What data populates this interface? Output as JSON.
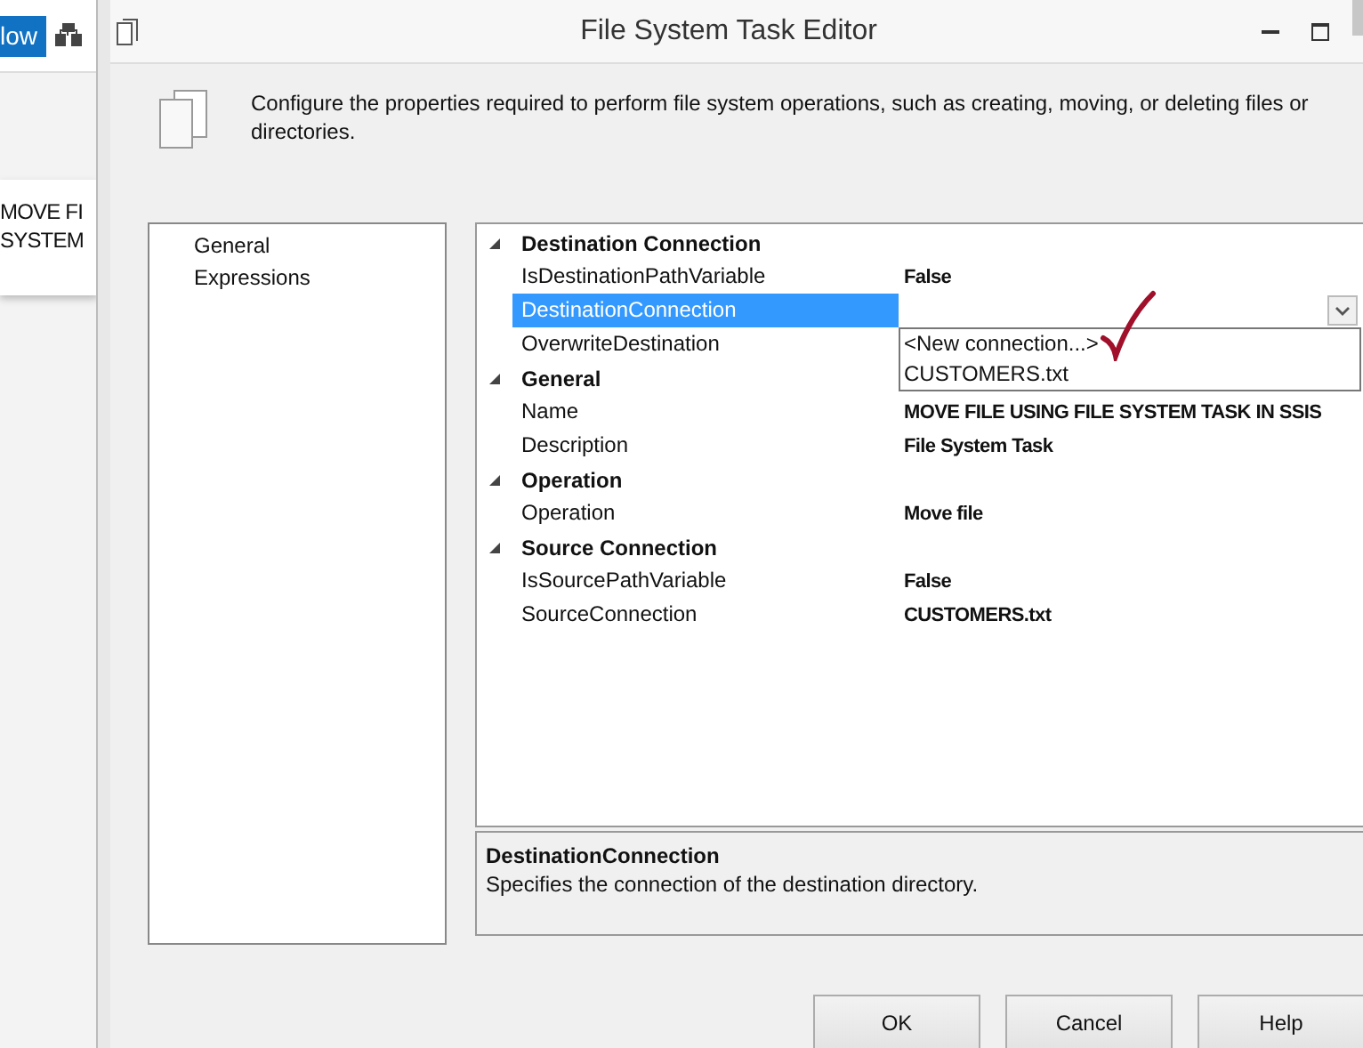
{
  "ide": {
    "toolbar_button": "low",
    "task_label_lines": [
      "MOVE FI",
      "SYSTEM"
    ]
  },
  "dialog": {
    "title": "File System Task Editor",
    "description": "Configure the properties required to perform file system operations, such as creating, moving, or deleting files or directories.",
    "pages": [
      {
        "label": "General"
      },
      {
        "label": "Expressions"
      }
    ],
    "property_grid": [
      {
        "name": "Destination Connection",
        "expanded": true,
        "properties": [
          {
            "name": "IsDestinationPathVariable",
            "kind": "text",
            "value": "False",
            "selected": false
          },
          {
            "name": "DestinationConnection",
            "kind": "dropdown",
            "selected": true,
            "open": true,
            "options": [
              "<New connection...>",
              "CUSTOMERS.txt"
            ]
          },
          {
            "name": "OverwriteDestination",
            "kind": "hidden",
            "selected": false
          }
        ]
      },
      {
        "name": "General",
        "expanded": true,
        "properties": [
          {
            "name": "Name",
            "kind": "text",
            "value": "MOVE FILE USING FILE SYSTEM TASK IN SSIS",
            "selected": false
          },
          {
            "name": "Description",
            "kind": "text",
            "value": "File System Task",
            "selected": false
          }
        ]
      },
      {
        "name": "Operation",
        "expanded": true,
        "properties": [
          {
            "name": "Operation",
            "kind": "text",
            "value": "Move file",
            "selected": false
          }
        ]
      },
      {
        "name": "Source Connection",
        "expanded": true,
        "properties": [
          {
            "name": "IsSourcePathVariable",
            "kind": "text",
            "value": "False",
            "selected": false
          },
          {
            "name": "SourceConnection",
            "kind": "text",
            "value": "CUSTOMERS.txt",
            "selected": false
          }
        ]
      }
    ],
    "help": {
      "title": "DestinationConnection",
      "text": "Specifies the connection of the destination directory."
    },
    "buttons": [
      "OK",
      "Cancel",
      "Help"
    ]
  }
}
